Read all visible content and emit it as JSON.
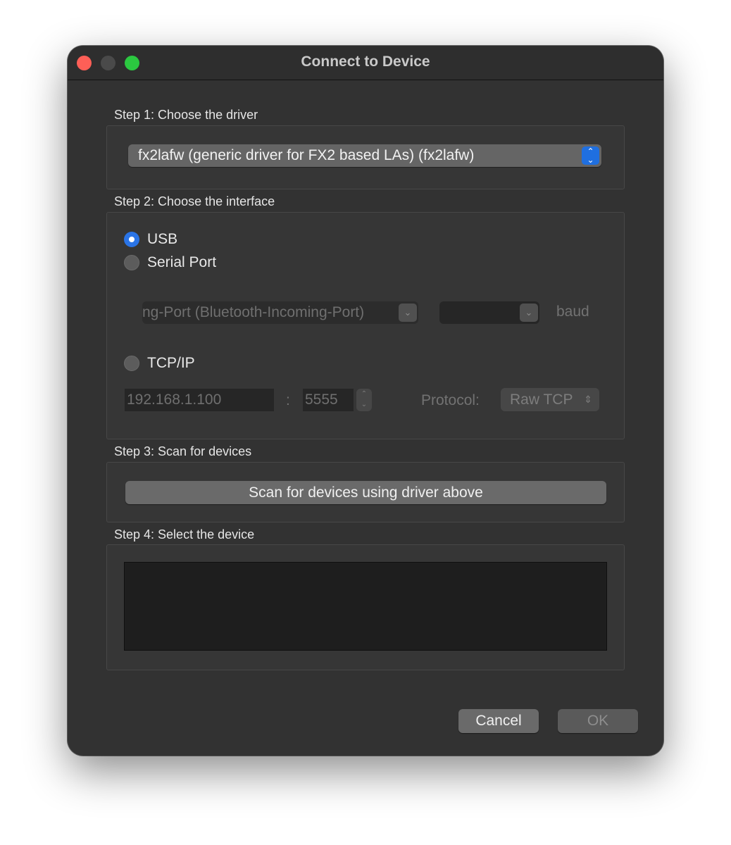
{
  "window": {
    "title": "Connect to Device"
  },
  "step1": {
    "label": "Step 1: Choose the driver",
    "driver_value": "fx2lafw (generic driver for FX2 based LAs) (fx2lafw)"
  },
  "step2": {
    "label": "Step 2: Choose the interface",
    "usb_label": "USB",
    "serial_label": "Serial Port",
    "serial_port_value": "ng-Port (Bluetooth-Incoming-Port)",
    "baud_value": "",
    "baud_label": "baud",
    "tcp_label": "TCP/IP",
    "host_placeholder": "192.168.1.100",
    "separator": ":",
    "port_placeholder": "5555",
    "protocol_label": "Protocol:",
    "protocol_value": "Raw TCP",
    "selected_interface": "USB"
  },
  "step3": {
    "label": "Step 3: Scan for devices",
    "scan_button": "Scan for devices using driver above"
  },
  "step4": {
    "label": "Step 4: Select the device",
    "devices": []
  },
  "buttons": {
    "cancel": "Cancel",
    "ok": "OK"
  },
  "colors": {
    "window_bg": "#323232",
    "accent": "#2a74e6",
    "close": "#fe5f57",
    "zoom": "#2bc840"
  }
}
